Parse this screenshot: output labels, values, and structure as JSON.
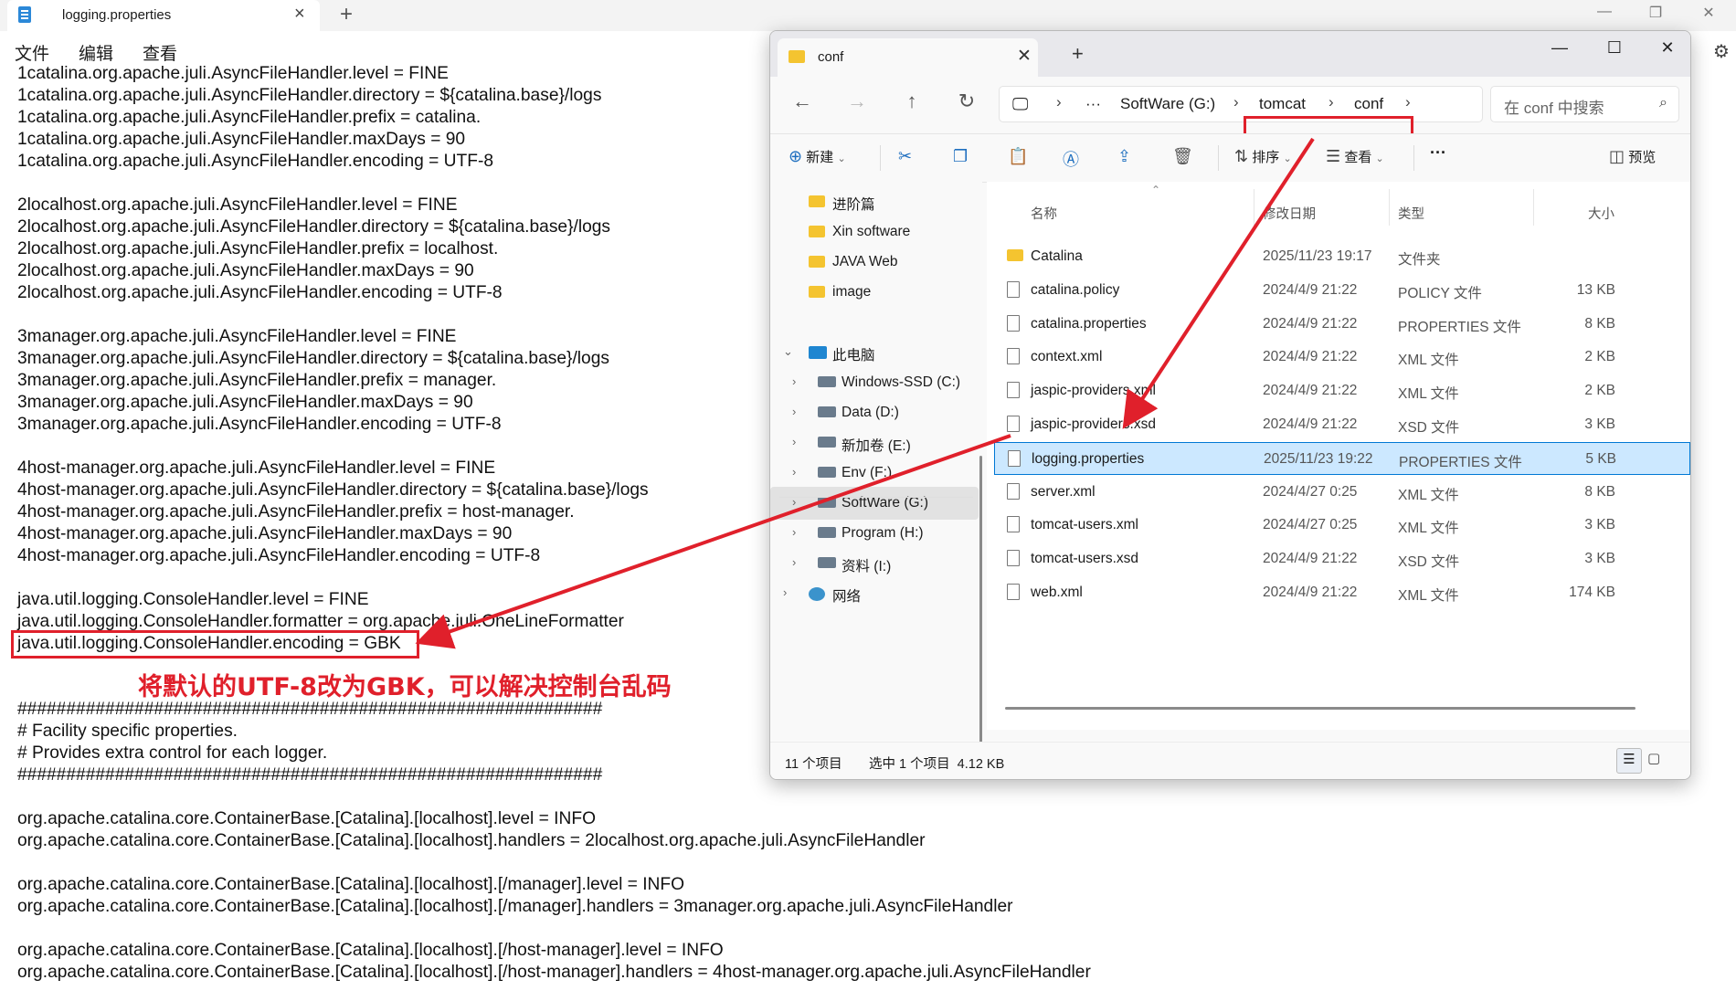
{
  "notepad": {
    "tab_title": "logging.properties",
    "menu": [
      "文件",
      "编辑",
      "查看"
    ],
    "lines": [
      "1catalina.org.apache.juli.AsyncFileHandler.level = FINE",
      "1catalina.org.apache.juli.AsyncFileHandler.directory = ${catalina.base}/logs",
      "1catalina.org.apache.juli.AsyncFileHandler.prefix = catalina.",
      "1catalina.org.apache.juli.AsyncFileHandler.maxDays = 90",
      "1catalina.org.apache.juli.AsyncFileHandler.encoding = UTF-8",
      "",
      "2localhost.org.apache.juli.AsyncFileHandler.level = FINE",
      "2localhost.org.apache.juli.AsyncFileHandler.directory = ${catalina.base}/logs",
      "2localhost.org.apache.juli.AsyncFileHandler.prefix = localhost.",
      "2localhost.org.apache.juli.AsyncFileHandler.maxDays = 90",
      "2localhost.org.apache.juli.AsyncFileHandler.encoding = UTF-8",
      "",
      "3manager.org.apache.juli.AsyncFileHandler.level = FINE",
      "3manager.org.apache.juli.AsyncFileHandler.directory = ${catalina.base}/logs",
      "3manager.org.apache.juli.AsyncFileHandler.prefix = manager.",
      "3manager.org.apache.juli.AsyncFileHandler.maxDays = 90",
      "3manager.org.apache.juli.AsyncFileHandler.encoding = UTF-8",
      "",
      "4host-manager.org.apache.juli.AsyncFileHandler.level = FINE",
      "4host-manager.org.apache.juli.AsyncFileHandler.directory = ${catalina.base}/logs",
      "4host-manager.org.apache.juli.AsyncFileHandler.prefix = host-manager.",
      "4host-manager.org.apache.juli.AsyncFileHandler.maxDays = 90",
      "4host-manager.org.apache.juli.AsyncFileHandler.encoding = UTF-8",
      "",
      "java.util.logging.ConsoleHandler.level = FINE",
      "java.util.logging.ConsoleHandler.formatter = org.apache.juli.OneLineFormatter",
      "java.util.logging.ConsoleHandler.encoding = GBK",
      "",
      "",
      "############################################################",
      "# Facility specific properties.",
      "# Provides extra control for each logger.",
      "############################################################",
      "",
      "org.apache.catalina.core.ContainerBase.[Catalina].[localhost].level = INFO",
      "org.apache.catalina.core.ContainerBase.[Catalina].[localhost].handlers = 2localhost.org.apache.juli.AsyncFileHandler",
      "",
      "org.apache.catalina.core.ContainerBase.[Catalina].[localhost].[/manager].level = INFO",
      "org.apache.catalina.core.ContainerBase.[Catalina].[localhost].[/manager].handlers = 3manager.org.apache.juli.AsyncFileHandler",
      "",
      "org.apache.catalina.core.ContainerBase.[Catalina].[localhost].[/host-manager].level = INFO",
      "org.apache.catalina.core.ContainerBase.[Catalina].[localhost].[/host-manager].handlers = 4host-manager.org.apache.juli.AsyncFileHandler"
    ],
    "annotation": "将默认的UTF-8改为GBK，可以解决控制台乱码"
  },
  "explorer": {
    "tab_title": "conf",
    "breadcrumb": [
      "SoftWare (G:)",
      "tomcat",
      "conf"
    ],
    "search_placeholder": "在 conf 中搜索",
    "toolbar": {
      "new": "新建",
      "sort": "排序",
      "view": "查看",
      "preview": "预览"
    },
    "nav": [
      {
        "label": "进阶篇",
        "icon": "folder-icon"
      },
      {
        "label": "Xin software",
        "icon": "folder-icon"
      },
      {
        "label": "JAVA Web",
        "icon": "folder-icon"
      },
      {
        "label": "image",
        "icon": "folder-icon"
      },
      {
        "label": "此电脑",
        "icon": "computer-icon"
      },
      {
        "label": "Windows-SSD (C:)",
        "icon": "drive-icon"
      },
      {
        "label": "Data (D:)",
        "icon": "drive-icon"
      },
      {
        "label": "新加卷 (E:)",
        "icon": "drive-icon"
      },
      {
        "label": "Env (F:)",
        "icon": "drive-icon"
      },
      {
        "label": "SoftWare (G:)",
        "icon": "drive-icon",
        "selected": true
      },
      {
        "label": "Program (H:)",
        "icon": "drive-icon"
      },
      {
        "label": "资料 (I:)",
        "icon": "drive-icon"
      },
      {
        "label": "网络",
        "icon": "network-icon"
      }
    ],
    "columns": {
      "name": "名称",
      "date": "修改日期",
      "type": "类型",
      "size": "大小"
    },
    "files": [
      {
        "name": "Catalina",
        "date": "2025/11/23 19:17",
        "type": "文件夹",
        "size": "",
        "kind": "folder"
      },
      {
        "name": "catalina.policy",
        "date": "2024/4/9 21:22",
        "type": "POLICY 文件",
        "size": "13 KB",
        "kind": "file"
      },
      {
        "name": "catalina.properties",
        "date": "2024/4/9 21:22",
        "type": "PROPERTIES 文件",
        "size": "8 KB",
        "kind": "file"
      },
      {
        "name": "context.xml",
        "date": "2024/4/9 21:22",
        "type": "XML 文件",
        "size": "2 KB",
        "kind": "file"
      },
      {
        "name": "jaspic-providers.xml",
        "date": "2024/4/9 21:22",
        "type": "XML 文件",
        "size": "2 KB",
        "kind": "file"
      },
      {
        "name": "jaspic-providers.xsd",
        "date": "2024/4/9 21:22",
        "type": "XSD 文件",
        "size": "3 KB",
        "kind": "file"
      },
      {
        "name": "logging.properties",
        "date": "2025/11/23 19:22",
        "type": "PROPERTIES 文件",
        "size": "5 KB",
        "kind": "file",
        "selected": true
      },
      {
        "name": "server.xml",
        "date": "2024/4/27 0:25",
        "type": "XML 文件",
        "size": "8 KB",
        "kind": "file"
      },
      {
        "name": "tomcat-users.xml",
        "date": "2024/4/27 0:25",
        "type": "XML 文件",
        "size": "3 KB",
        "kind": "file"
      },
      {
        "name": "tomcat-users.xsd",
        "date": "2024/4/9 21:22",
        "type": "XSD 文件",
        "size": "3 KB",
        "kind": "file"
      },
      {
        "name": "web.xml",
        "date": "2024/4/9 21:22",
        "type": "XML 文件",
        "size": "174 KB",
        "kind": "file"
      }
    ],
    "status": {
      "count": "11 个项目",
      "selection": "选中 1 个项目  4.12 KB"
    }
  },
  "colors": {
    "annotation_red": "#e0202b",
    "selection_blue": "#cce8ff",
    "accent": "#0078d4"
  }
}
